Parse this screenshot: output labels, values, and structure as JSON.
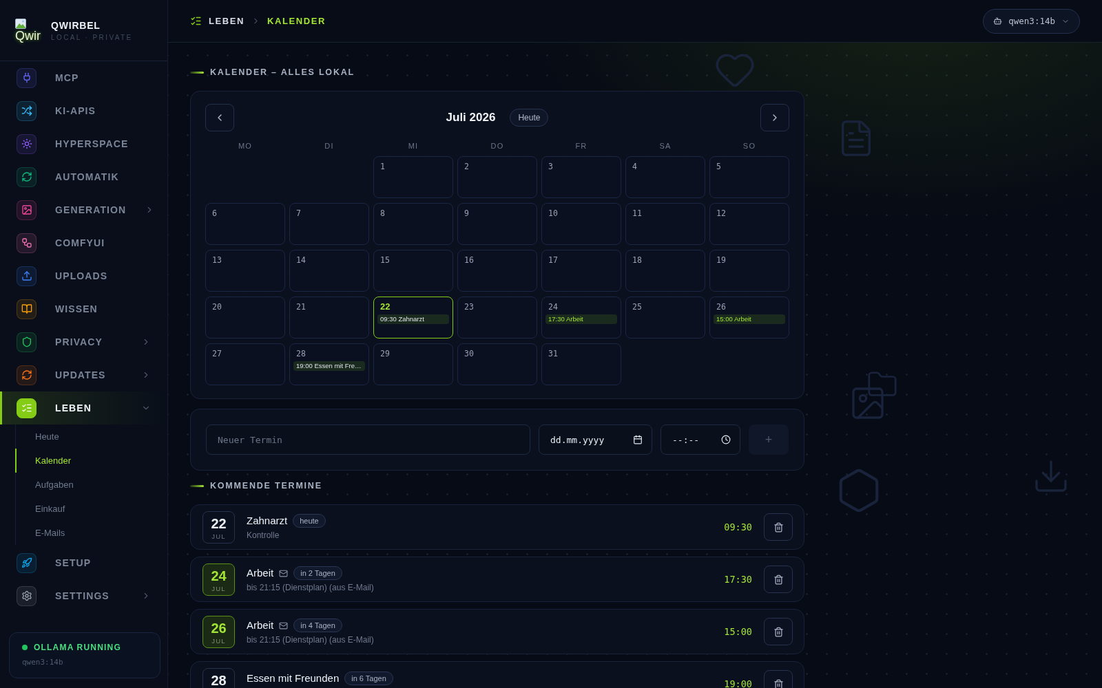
{
  "sidebar": {
    "logo": {
      "alt_text": "Qwir"
    },
    "brand": "QWIRBEL",
    "tagline": "LOCAL · PRIVATE",
    "nav": [
      {
        "label": "MCP",
        "color": "#6366f1",
        "selected": false,
        "expandable": false,
        "expanded": false
      },
      {
        "label": "KI-APIS",
        "color": "#38bdf8",
        "selected": false,
        "expandable": false,
        "expanded": false
      },
      {
        "label": "HYPERSPACE",
        "color": "#8b5cf6",
        "selected": false,
        "expandable": false,
        "expanded": false
      },
      {
        "label": "AUTOMATIK",
        "color": "#10b981",
        "selected": false,
        "expandable": false,
        "expanded": false
      },
      {
        "label": "GENERATION",
        "color": "#ec4899",
        "selected": false,
        "expandable": true,
        "expanded": false
      },
      {
        "label": "COMFYUI",
        "color": "#f472b6",
        "selected": false,
        "expandable": false,
        "expanded": false
      },
      {
        "label": "UPLOADS",
        "color": "#3b82f6",
        "selected": false,
        "expandable": false,
        "expanded": false
      },
      {
        "label": "WISSEN",
        "color": "#f59e0b",
        "selected": false,
        "expandable": false,
        "expanded": false
      },
      {
        "label": "PRIVACY",
        "color": "#22c55e",
        "selected": false,
        "expandable": true,
        "expanded": false
      },
      {
        "label": "UPDATES",
        "color": "#f97316",
        "selected": false,
        "expandable": true,
        "expanded": false
      },
      {
        "label": "LEBEN",
        "color": "#84cc16",
        "selected": true,
        "expandable": true,
        "expanded": true,
        "children": [
          {
            "label": "Heute",
            "selected": false
          },
          {
            "label": "Kalender",
            "selected": true
          },
          {
            "label": "Aufgaben",
            "selected": false
          },
          {
            "label": "Einkauf",
            "selected": false
          },
          {
            "label": "E-Mails",
            "selected": false
          }
        ]
      },
      {
        "label": "SETUP",
        "color": "#0ea5e9",
        "selected": false,
        "expandable": false,
        "expanded": false
      },
      {
        "label": "SETTINGS",
        "color": "#9ca3af",
        "selected": false,
        "expandable": true,
        "expanded": false
      }
    ],
    "status": {
      "label": "OLLAMA RUNNING",
      "running": true,
      "model": "qwen3:14b"
    }
  },
  "topbar": {
    "breadcrumb": [
      {
        "label": "LEBEN",
        "current": false
      },
      {
        "label": "KALENDER",
        "current": true
      }
    ],
    "model_select": {
      "value": "qwen3:14b"
    }
  },
  "calendar": {
    "section_title": "KALENDER – ALLES LOKAL",
    "month_title": "Juli 2026",
    "today_button": "Heute",
    "weekdays": [
      "MO",
      "DI",
      "MI",
      "DO",
      "FR",
      "SA",
      "SO"
    ],
    "days": [
      {
        "kind": "empty"
      },
      {
        "kind": "empty"
      },
      {
        "kind": "day",
        "day": "1",
        "today": false
      },
      {
        "kind": "day",
        "day": "2",
        "today": false
      },
      {
        "kind": "day",
        "day": "3",
        "today": false
      },
      {
        "kind": "day",
        "day": "4",
        "today": false
      },
      {
        "kind": "day",
        "day": "5",
        "today": false
      },
      {
        "kind": "day",
        "day": "6",
        "today": false
      },
      {
        "kind": "day",
        "day": "7",
        "today": false
      },
      {
        "kind": "day",
        "day": "8",
        "today": false
      },
      {
        "kind": "day",
        "day": "9",
        "today": false
      },
      {
        "kind": "day",
        "day": "10",
        "today": false
      },
      {
        "kind": "day",
        "day": "11",
        "today": false
      },
      {
        "kind": "day",
        "day": "12",
        "today": false
      },
      {
        "kind": "day",
        "day": "13",
        "today": false
      },
      {
        "kind": "day",
        "day": "14",
        "today": false
      },
      {
        "kind": "day",
        "day": "15",
        "today": false
      },
      {
        "kind": "day",
        "day": "16",
        "today": false
      },
      {
        "kind": "day",
        "day": "17",
        "today": false
      },
      {
        "kind": "day",
        "day": "18",
        "today": false
      },
      {
        "kind": "day",
        "day": "19",
        "today": false
      },
      {
        "kind": "day",
        "day": "20",
        "today": false
      },
      {
        "kind": "day",
        "day": "21",
        "today": false
      },
      {
        "kind": "day",
        "day": "22",
        "today": true,
        "events": [
          {
            "label": "09:30 Zahnarzt",
            "kind": "manual"
          }
        ]
      },
      {
        "kind": "day",
        "day": "23",
        "today": false
      },
      {
        "kind": "day",
        "day": "24",
        "today": false,
        "events": [
          {
            "label": "17:30 Arbeit",
            "kind": "mail"
          }
        ]
      },
      {
        "kind": "day",
        "day": "25",
        "today": false
      },
      {
        "kind": "day",
        "day": "26",
        "today": false,
        "events": [
          {
            "label": "15:00 Arbeit",
            "kind": "mail"
          }
        ]
      },
      {
        "kind": "day",
        "day": "27",
        "today": false
      },
      {
        "kind": "day",
        "day": "28",
        "today": false,
        "events": [
          {
            "label": "19:00 Essen mit Fre…",
            "kind": "manual"
          }
        ]
      },
      {
        "kind": "day",
        "day": "29",
        "today": false
      },
      {
        "kind": "day",
        "day": "30",
        "today": false
      },
      {
        "kind": "day",
        "day": "31",
        "today": false
      }
    ]
  },
  "new_event": {
    "title_field": {
      "placeholder": "Neuer Termin"
    },
    "date_field": {
      "placeholder": "dd.mm.yyyy"
    },
    "time_field": {
      "placeholder": "--:--"
    },
    "add_button": {
      "label": "+",
      "disabled": true
    }
  },
  "upcoming": {
    "section_title": "KOMMENDE TERMINE",
    "items": [
      {
        "day": "22",
        "month": "JUL",
        "title": "Zahnarzt",
        "kind": "manual",
        "badge": "heute",
        "note": "Kontrolle",
        "time": "09:30"
      },
      {
        "day": "24",
        "month": "JUL",
        "title": "Arbeit",
        "kind": "mail",
        "badge": "in 2 Tagen",
        "note": "bis 21:15 (Dienstplan) (aus E-Mail)",
        "time": "17:30"
      },
      {
        "day": "26",
        "month": "JUL",
        "title": "Arbeit",
        "kind": "mail",
        "badge": "in 4 Tagen",
        "note": "bis 21:15 (Dienstplan) (aus E-Mail)",
        "time": "15:00"
      },
      {
        "day": "28",
        "title": "Essen mit Freunden",
        "kind": "manual",
        "badge": "in 6 Tagen",
        "time": "19:00"
      }
    ]
  }
}
